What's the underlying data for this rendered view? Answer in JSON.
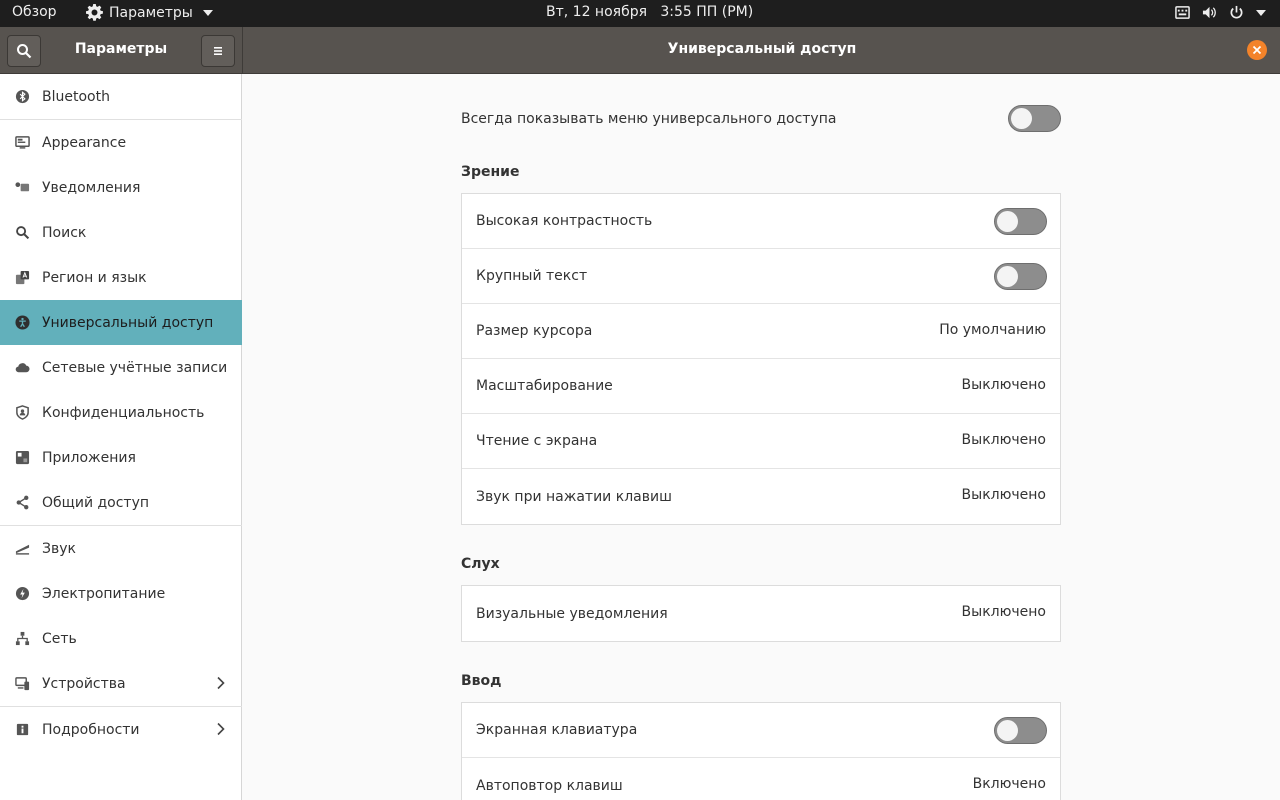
{
  "topbar": {
    "activities": "Обзор",
    "app_menu": "Параметры",
    "clock": "Вт, 12 ноября   3:55 ПП (PM)"
  },
  "sidebar": {
    "title": "Параметры",
    "items": [
      {
        "label": "Bluetooth",
        "icon": "bluetooth-icon"
      },
      {
        "label": "Appearance",
        "icon": "appearance-icon"
      },
      {
        "label": "Уведомления",
        "icon": "notifications-icon"
      },
      {
        "label": "Поиск",
        "icon": "search-icon"
      },
      {
        "label": "Регион и язык",
        "icon": "region-language-icon"
      },
      {
        "label": "Универсальный доступ",
        "icon": "accessibility-icon",
        "active": true
      },
      {
        "label": "Сетевые учётные записи",
        "icon": "cloud-icon"
      },
      {
        "label": "Конфиденциальность",
        "icon": "privacy-icon"
      },
      {
        "label": "Приложения",
        "icon": "apps-icon"
      },
      {
        "label": "Общий доступ",
        "icon": "share-icon"
      },
      {
        "label": "Звук",
        "icon": "sound-icon"
      },
      {
        "label": "Электропитание",
        "icon": "power-icon"
      },
      {
        "label": "Сеть",
        "icon": "network-icon"
      },
      {
        "label": "Устройства",
        "icon": "devices-icon",
        "chevron": true
      },
      {
        "label": "Подробности",
        "icon": "info-icon",
        "chevron": true
      }
    ]
  },
  "main": {
    "title": "Универсальный доступ",
    "always_show_label": "Всегда показывать меню универсального доступа",
    "always_show_on": false,
    "sections": {
      "vision": {
        "title": "Зрение",
        "rows": [
          {
            "label": "Высокая контрастность",
            "switch": false
          },
          {
            "label": "Крупный текст",
            "switch": false
          },
          {
            "label": "Размер курсора",
            "value": "По умолчанию"
          },
          {
            "label": "Масштабирование",
            "value": "Выключено"
          },
          {
            "label": "Чтение с экрана",
            "value": "Выключено"
          },
          {
            "label": "Звук при нажатии клавиш",
            "value": "Выключено"
          }
        ]
      },
      "hearing": {
        "title": "Слух",
        "rows": [
          {
            "label": "Визуальные уведомления",
            "value": "Выключено"
          }
        ]
      },
      "typing": {
        "title": "Ввод",
        "rows": [
          {
            "label": "Экранная клавиатура",
            "switch": false
          },
          {
            "label": "Автоповтор клавиш",
            "value": "Включено"
          }
        ]
      }
    }
  },
  "colors": {
    "accent": "#62b0bb",
    "header": "#57534f",
    "close": "#f3832a",
    "topbar": "#1e1e1e"
  }
}
